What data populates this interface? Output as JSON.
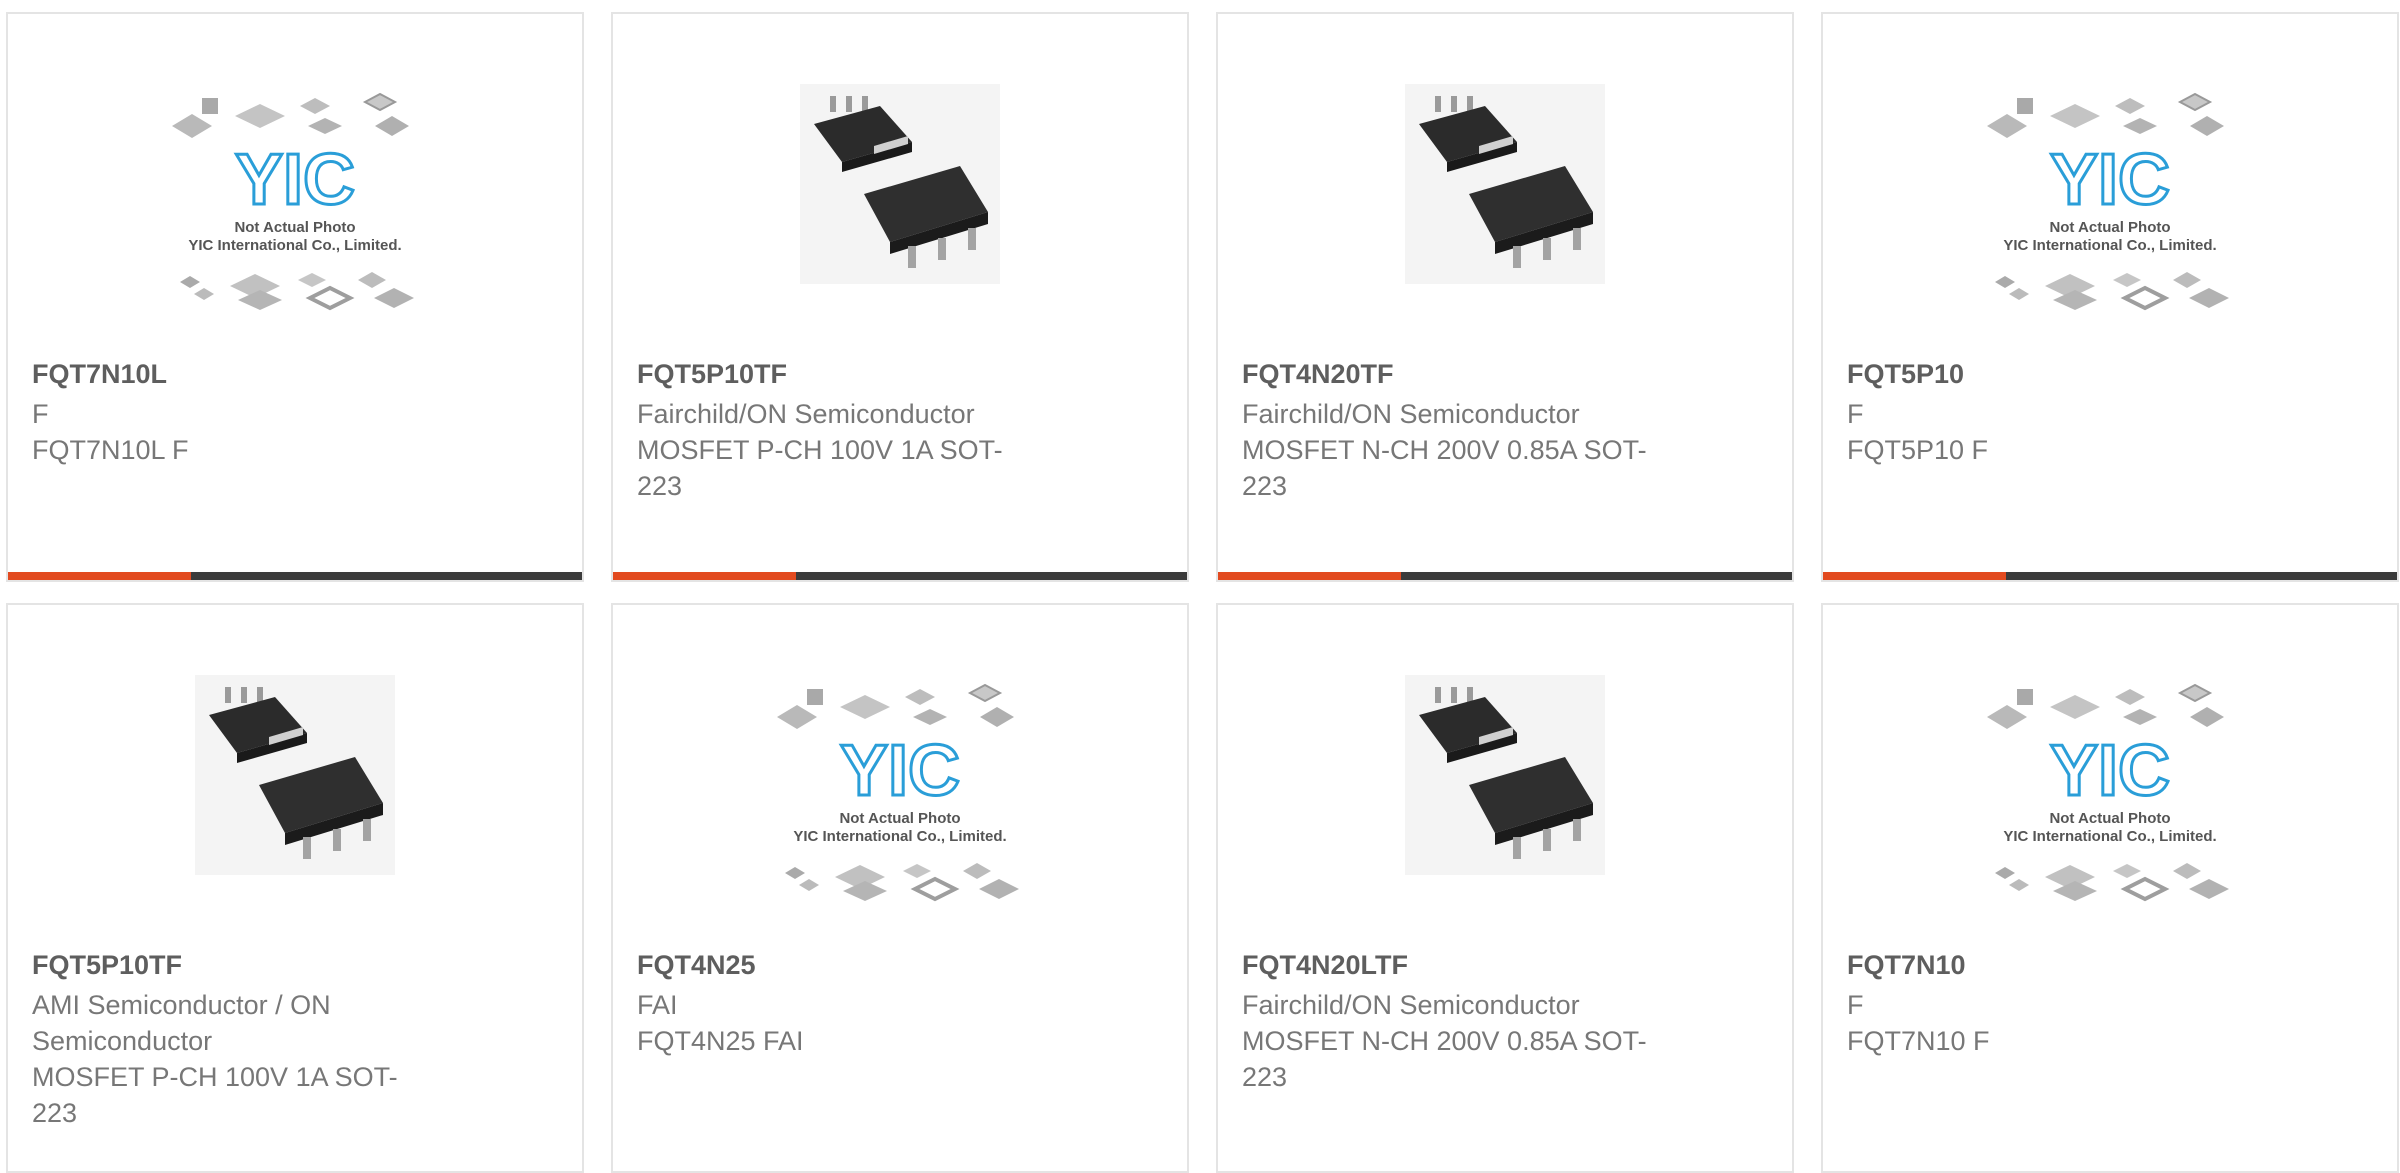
{
  "colors": {
    "accent": "#e24a1f",
    "bar_dark": "#3b3b3b",
    "card_border": "#e4e4e4",
    "text_title": "#5e5e5e",
    "text_body": "#777777",
    "logo_blue": "#2a9ed8"
  },
  "placeholder": {
    "not_actual": "Not Actual Photo",
    "company": "YIC International Co., Limited."
  },
  "products": [
    {
      "part": "FQT7N10L",
      "mfr": "F",
      "desc": "FQT7N10L F",
      "image": "placeholder",
      "bar": true
    },
    {
      "part": "FQT5P10TF",
      "mfr": "Fairchild/ON Semiconductor",
      "desc": "MOSFET P-CH 100V 1A SOT-223",
      "image": "sot223",
      "bar": true
    },
    {
      "part": "FQT4N20TF",
      "mfr": "Fairchild/ON Semiconductor",
      "desc": "MOSFET N-CH 200V 0.85A SOT-223",
      "image": "sot223",
      "bar": true
    },
    {
      "part": "FQT5P10",
      "mfr": "F",
      "desc": "FQT5P10 F",
      "image": "placeholder",
      "bar": true
    },
    {
      "part": "FQT5P10TF",
      "mfr": "AMI Semiconductor / ON Semiconductor",
      "desc": "MOSFET P-CH 100V 1A SOT-223",
      "image": "sot223",
      "bar": false
    },
    {
      "part": "FQT4N25",
      "mfr": "FAI",
      "desc": "FQT4N25 FAI",
      "image": "placeholder",
      "bar": false
    },
    {
      "part": "FQT4N20LTF",
      "mfr": "Fairchild/ON Semiconductor",
      "desc": "MOSFET N-CH 200V 0.85A SOT-223",
      "image": "sot223",
      "bar": false
    },
    {
      "part": "FQT7N10",
      "mfr": "F",
      "desc": "FQT7N10 F",
      "image": "placeholder",
      "bar": false
    }
  ]
}
